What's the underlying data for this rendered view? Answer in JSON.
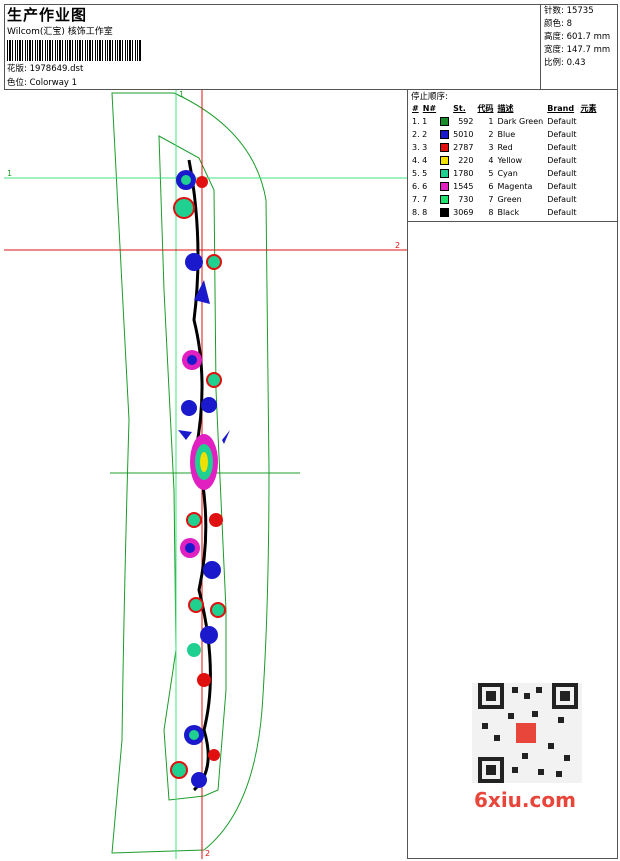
{
  "header": {
    "title": "生产作业图",
    "studio": "Wilcom(汇宝) 核饰工作室",
    "design_label": "花版: 1978649.dst",
    "colorway_label": "色位: Colorway 1"
  },
  "stats": {
    "stitches": "针数: 15735",
    "colors": "颜色: 8",
    "height": "高度: 601.7 mm",
    "width": "宽度: 147.7 mm",
    "scale": "比例: 0.43"
  },
  "stop_sequence": {
    "title": "停止顺序:",
    "columns": [
      "#",
      "N#",
      "St.",
      "代码",
      "描述",
      "Brand",
      "元素"
    ],
    "rows": [
      {
        "idx": "1. 1",
        "st": "592",
        "code": "1",
        "desc": "Dark Green",
        "brand": "Default",
        "color": "#1a8c2a"
      },
      {
        "idx": "2. 2",
        "st": "5010",
        "code": "2",
        "desc": "Blue",
        "brand": "Default",
        "color": "#1a1acc"
      },
      {
        "idx": "3. 3",
        "st": "2787",
        "code": "3",
        "desc": "Red",
        "brand": "Default",
        "color": "#e01010"
      },
      {
        "idx": "4. 4",
        "st": "220",
        "code": "4",
        "desc": "Yellow",
        "brand": "Default",
        "color": "#f0e000"
      },
      {
        "idx": "5. 5",
        "st": "1780",
        "code": "5",
        "desc": "Cyan",
        "brand": "Default",
        "color": "#20d090"
      },
      {
        "idx": "6. 6",
        "st": "1545",
        "code": "6",
        "desc": "Magenta",
        "brand": "Default",
        "color": "#e020c0"
      },
      {
        "idx": "7. 7",
        "st": "730",
        "code": "7",
        "desc": "Green",
        "brand": "Default",
        "color": "#20e070"
      },
      {
        "idx": "8. 8",
        "st": "3069",
        "code": "8",
        "desc": "Black",
        "brand": "Default",
        "color": "#000000"
      }
    ]
  },
  "guides": {
    "v1": "1",
    "h1": "1",
    "h2": "2",
    "v2": "2"
  },
  "watermark": "6xiu.com"
}
